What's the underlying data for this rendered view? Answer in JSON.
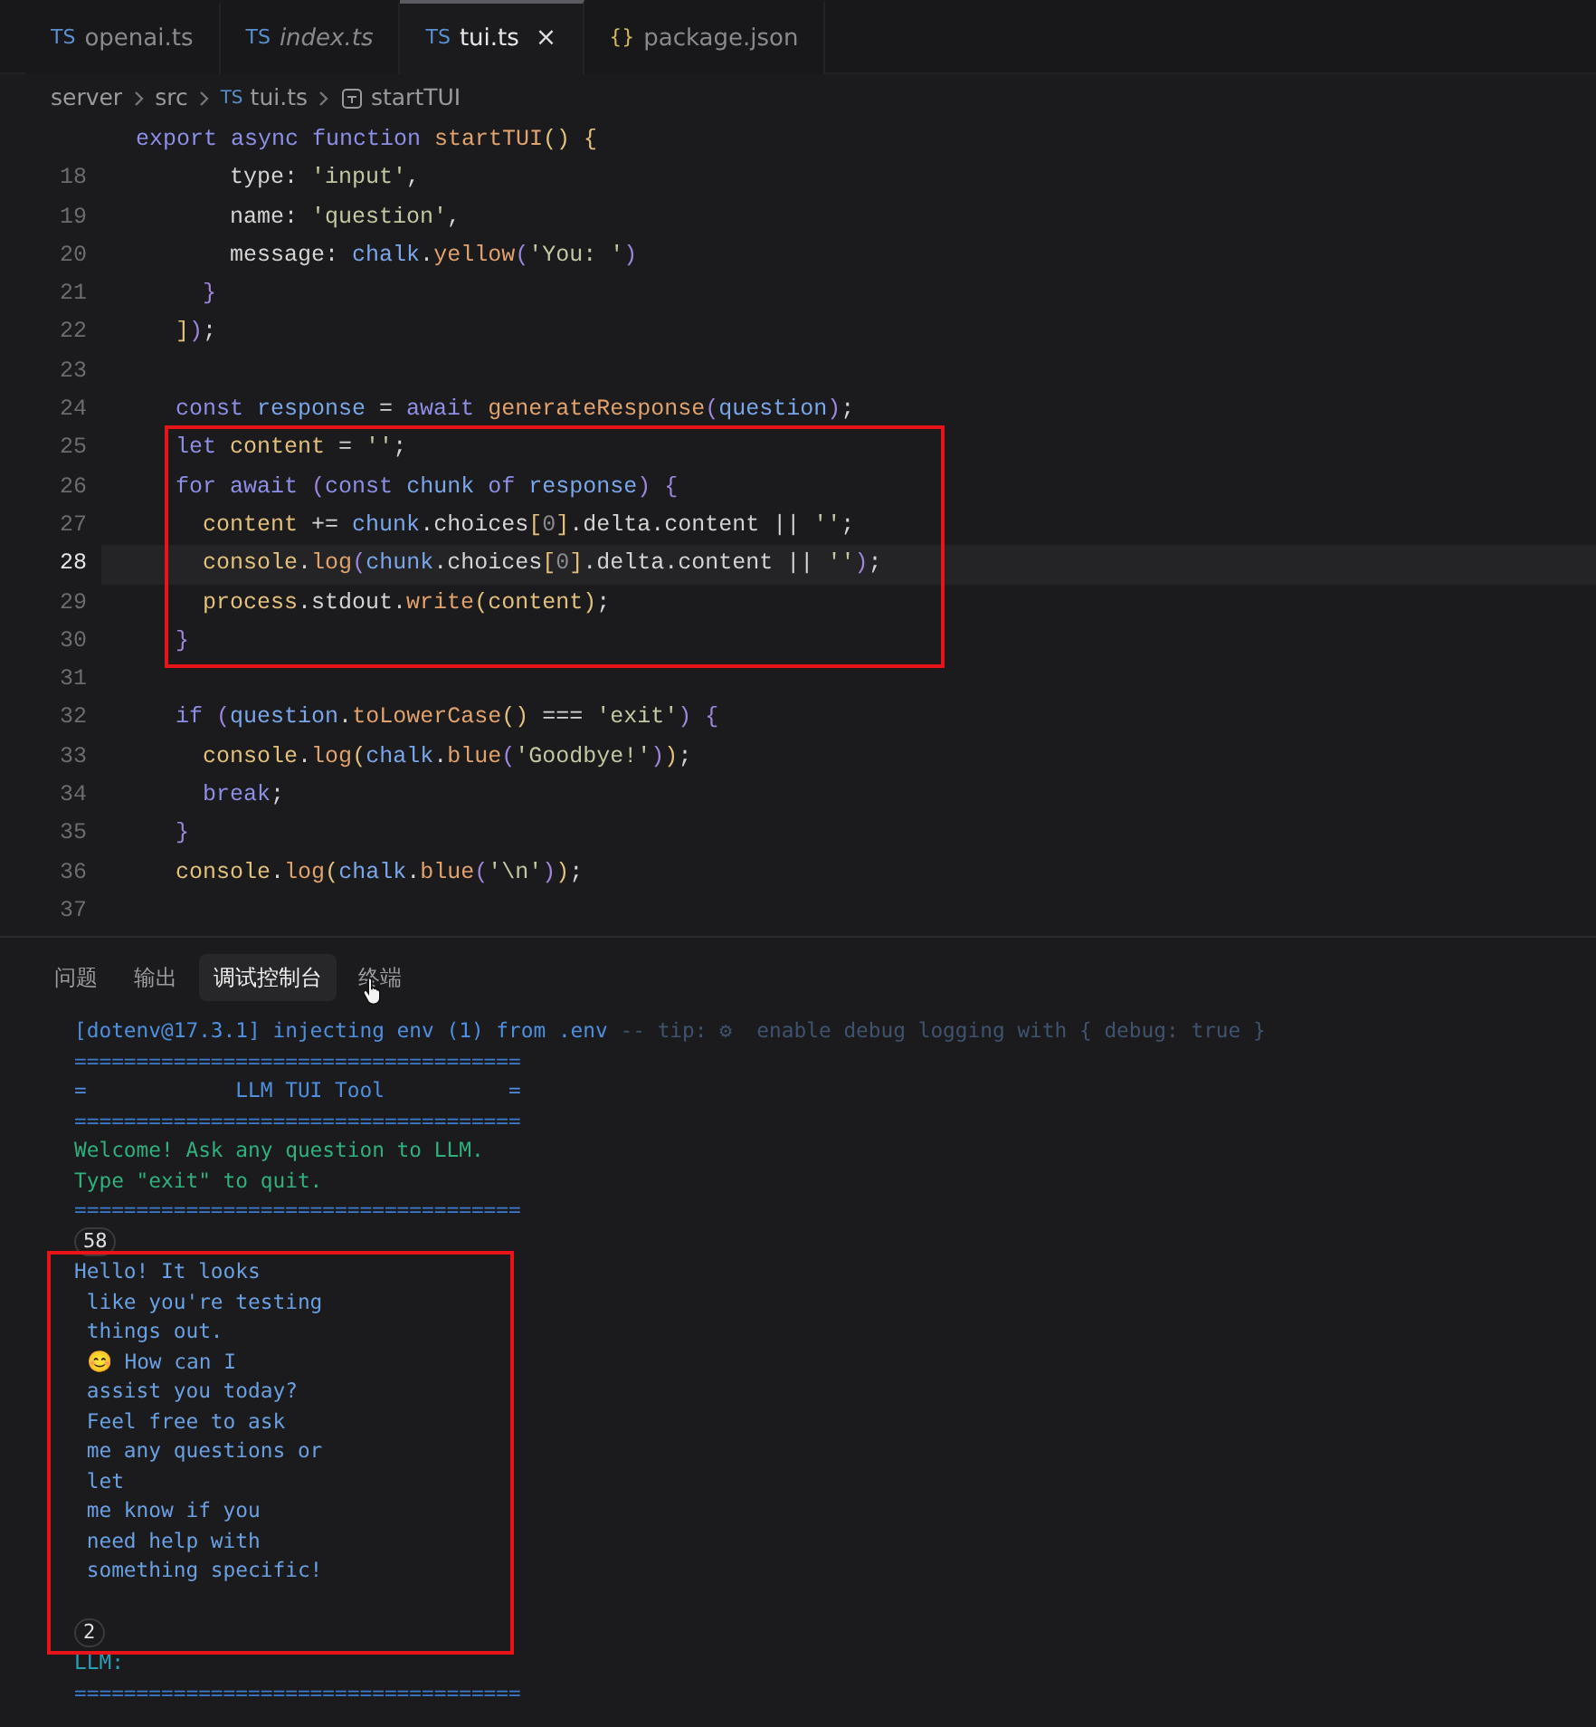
{
  "editor_tabs": [
    {
      "icon": "TS",
      "color": "#5a8fd0",
      "label": "openai.ts",
      "italic": false,
      "selected": false
    },
    {
      "icon": "TS",
      "color": "#5a8fd0",
      "label": "index.ts",
      "italic": true,
      "selected": false
    },
    {
      "icon": "TS",
      "color": "#5a8fd0",
      "label": "tui.ts",
      "italic": false,
      "selected": true,
      "close": "×"
    },
    {
      "icon": "{}",
      "color": "#d7ba5d",
      "label": "package.json",
      "italic": false,
      "selected": false
    }
  ],
  "breadcrumb": [
    {
      "kind": "folder",
      "label": "server"
    },
    {
      "kind": "folder",
      "label": "src"
    },
    {
      "kind": "file",
      "icon": "TS",
      "label": "tui.ts"
    },
    {
      "kind": "symbol",
      "label": "startTUI"
    }
  ],
  "sticky_line": {
    "tokens": [
      {
        "text": "export async function ",
        "color": "#8d8fe6"
      },
      {
        "text": "startTUI",
        "color": "#e2a26c"
      },
      {
        "text": "() {",
        "color": "#e3c07c"
      }
    ]
  },
  "code_lines": [
    {
      "number": "18",
      "current": false,
      "boxed": false,
      "tokens": [
        {
          "text": "        type: ",
          "color": "#d4d4d4"
        },
        {
          "text": "'input'",
          "color": "#c2c8a2"
        },
        {
          "text": ",",
          "color": "#d4d4d4"
        }
      ]
    },
    {
      "number": "19",
      "current": false,
      "boxed": false,
      "tokens": [
        {
          "text": "        name: ",
          "color": "#d4d4d4"
        },
        {
          "text": "'question'",
          "color": "#c2c8a2"
        },
        {
          "text": ",",
          "color": "#d4d4d4"
        }
      ]
    },
    {
      "number": "20",
      "current": false,
      "boxed": false,
      "tokens": [
        {
          "text": "        message: ",
          "color": "#d4d4d4"
        },
        {
          "text": "chalk",
          "color": "#7aa6ea"
        },
        {
          "text": ".",
          "color": "#d4d4d4"
        },
        {
          "text": "yellow",
          "color": "#e2a26c"
        },
        {
          "text": "(",
          "color": "#9d86db"
        },
        {
          "text": "'You: '",
          "color": "#c2c8a2"
        },
        {
          "text": ")",
          "color": "#9d86db"
        }
      ]
    },
    {
      "number": "21",
      "current": false,
      "boxed": false,
      "tokens": [
        {
          "text": "      }",
          "color": "#9d86db"
        }
      ]
    },
    {
      "number": "22",
      "current": false,
      "boxed": false,
      "tokens": [
        {
          "text": "    ]",
          "color": "#e3c07c"
        },
        {
          "text": ")",
          "color": "#9d86db"
        },
        {
          "text": ";",
          "color": "#d4d4d4"
        }
      ]
    },
    {
      "number": "23",
      "current": false,
      "boxed": false
    },
    {
      "number": "24",
      "current": false,
      "boxed": false,
      "tokens": [
        {
          "text": "    const ",
          "color": "#8d8fe6"
        },
        {
          "text": "response",
          "color": "#7aa6ea"
        },
        {
          "text": " = ",
          "color": "#d4d4d4"
        },
        {
          "text": "await ",
          "color": "#8d8fe6"
        },
        {
          "text": "generateResponse",
          "color": "#e2a26c"
        },
        {
          "text": "(",
          "color": "#9d86db"
        },
        {
          "text": "question",
          "color": "#7aa6ea"
        },
        {
          "text": ")",
          "color": "#9d86db"
        },
        {
          "text": ";",
          "color": "#d4d4d4"
        }
      ]
    },
    {
      "number": "25",
      "current": false,
      "boxed": true,
      "tokens": [
        {
          "text": "    let ",
          "color": "#8d8fe6"
        },
        {
          "text": "content",
          "color": "#e3c07c"
        },
        {
          "text": " = ",
          "color": "#d4d4d4"
        },
        {
          "text": "''",
          "color": "#c2c8a2"
        },
        {
          "text": ";",
          "color": "#d4d4d4"
        }
      ]
    },
    {
      "number": "26",
      "current": false,
      "boxed": true,
      "tokens": [
        {
          "text": "    for await ",
          "color": "#8d8fe6"
        },
        {
          "text": "(",
          "color": "#9d86db"
        },
        {
          "text": "const ",
          "color": "#8d8fe6"
        },
        {
          "text": "chunk ",
          "color": "#7aa6ea"
        },
        {
          "text": "of ",
          "color": "#8d8fe6"
        },
        {
          "text": "response",
          "color": "#7aa6ea"
        },
        {
          "text": ") {",
          "color": "#9d86db"
        }
      ]
    },
    {
      "number": "27",
      "current": false,
      "boxed": true,
      "tokens": [
        {
          "text": "      content",
          "color": "#e3c07c"
        },
        {
          "text": " += ",
          "color": "#d4d4d4"
        },
        {
          "text": "chunk",
          "color": "#7aa6ea"
        },
        {
          "text": ".choices",
          "color": "#d4d4d4"
        },
        {
          "text": "[",
          "color": "#e3c07c"
        },
        {
          "text": "0",
          "color": "#8a8a8e"
        },
        {
          "text": "]",
          "color": "#e3c07c"
        },
        {
          "text": ".delta.content || ",
          "color": "#d4d4d4"
        },
        {
          "text": "''",
          "color": "#c2c8a2"
        },
        {
          "text": ";",
          "color": "#d4d4d4"
        }
      ]
    },
    {
      "number": "28",
      "current": true,
      "boxed": true,
      "tokens": [
        {
          "text": "      console",
          "color": "#e3c07c"
        },
        {
          "text": ".",
          "color": "#d4d4d4"
        },
        {
          "text": "log",
          "color": "#e2a26c"
        },
        {
          "text": "(",
          "color": "#9d86db"
        },
        {
          "text": "chunk",
          "color": "#7aa6ea"
        },
        {
          "text": ".choices",
          "color": "#d4d4d4"
        },
        {
          "text": "[",
          "color": "#e3c07c"
        },
        {
          "text": "0",
          "color": "#8a8a8e"
        },
        {
          "text": "]",
          "color": "#e3c07c"
        },
        {
          "text": ".delta.content || ",
          "color": "#d4d4d4"
        },
        {
          "text": "''",
          "color": "#c2c8a2"
        },
        {
          "text": ")",
          "color": "#9d86db"
        },
        {
          "text": ";",
          "color": "#d4d4d4"
        }
      ]
    },
    {
      "number": "29",
      "current": false,
      "boxed": true,
      "tokens": [
        {
          "text": "      process",
          "color": "#e3c07c"
        },
        {
          "text": ".stdout.",
          "color": "#d4d4d4"
        },
        {
          "text": "write",
          "color": "#e2a26c"
        },
        {
          "text": "(",
          "color": "#e3c07c"
        },
        {
          "text": "content",
          "color": "#e3c07c"
        },
        {
          "text": ")",
          "color": "#e3c07c"
        },
        {
          "text": ";",
          "color": "#d4d4d4"
        }
      ]
    },
    {
      "number": "30",
      "current": false,
      "boxed": true,
      "tokens": [
        {
          "text": "    }",
          "color": "#9d86db"
        }
      ]
    },
    {
      "number": "31",
      "current": false,
      "boxed": false
    },
    {
      "number": "32",
      "current": false,
      "boxed": false,
      "tokens": [
        {
          "text": "    if ",
          "color": "#8d8fe6"
        },
        {
          "text": "(",
          "color": "#9d86db"
        },
        {
          "text": "question",
          "color": "#7aa6ea"
        },
        {
          "text": ".",
          "color": "#d4d4d4"
        },
        {
          "text": "toLowerCase",
          "color": "#e2a26c"
        },
        {
          "text": "()",
          "color": "#e3c07c"
        },
        {
          "text": " === ",
          "color": "#d4d4d4"
        },
        {
          "text": "'exit'",
          "color": "#c2c8a2"
        },
        {
          "text": ") {",
          "color": "#9d86db"
        }
      ]
    },
    {
      "number": "33",
      "current": false,
      "boxed": false,
      "tokens": [
        {
          "text": "      console",
          "color": "#e3c07c"
        },
        {
          "text": ".",
          "color": "#d4d4d4"
        },
        {
          "text": "log",
          "color": "#e2a26c"
        },
        {
          "text": "(",
          "color": "#e3c07c"
        },
        {
          "text": "chalk",
          "color": "#7aa6ea"
        },
        {
          "text": ".",
          "color": "#d4d4d4"
        },
        {
          "text": "blue",
          "color": "#e2a26c"
        },
        {
          "text": "(",
          "color": "#9d86db"
        },
        {
          "text": "'Goodbye!'",
          "color": "#c2c8a2"
        },
        {
          "text": ")",
          "color": "#9d86db"
        },
        {
          "text": ")",
          "color": "#e3c07c"
        },
        {
          "text": ";",
          "color": "#d4d4d4"
        }
      ]
    },
    {
      "number": "34",
      "current": false,
      "boxed": false,
      "tokens": [
        {
          "text": "      break",
          "color": "#8d8fe6"
        },
        {
          "text": ";",
          "color": "#d4d4d4"
        }
      ]
    },
    {
      "number": "35",
      "current": false,
      "boxed": false,
      "tokens": [
        {
          "text": "    }",
          "color": "#9d86db"
        }
      ]
    },
    {
      "number": "36",
      "current": false,
      "boxed": false,
      "tokens": [
        {
          "text": "    console",
          "color": "#e3c07c"
        },
        {
          "text": ".",
          "color": "#d4d4d4"
        },
        {
          "text": "log",
          "color": "#e2a26c"
        },
        {
          "text": "(",
          "color": "#e3c07c"
        },
        {
          "text": "chalk",
          "color": "#7aa6ea"
        },
        {
          "text": ".",
          "color": "#d4d4d4"
        },
        {
          "text": "blue",
          "color": "#e2a26c"
        },
        {
          "text": "(",
          "color": "#9d86db"
        },
        {
          "text": "'\\n'",
          "color": "#c2c8a2"
        },
        {
          "text": ")",
          "color": "#9d86db"
        },
        {
          "text": ")",
          "color": "#e3c07c"
        },
        {
          "text": ";",
          "color": "#d4d4d4"
        }
      ]
    },
    {
      "number": "37",
      "current": false,
      "boxed": false
    }
  ],
  "panel_tabs": [
    {
      "label": "问题",
      "selected": false,
      "hovered": false
    },
    {
      "label": "输出",
      "selected": false,
      "hovered": false
    },
    {
      "label": "调试控制台",
      "selected": true,
      "hovered": false
    },
    {
      "label": "终端",
      "selected": false,
      "hovered": true
    }
  ],
  "terminal_lines": [
    {
      "kind": "text",
      "boxed": false,
      "segments": [
        {
          "text": "[dotenv@17.3.1] injecting env (1) from .env ",
          "color": "#4f8fe0"
        },
        {
          "text": "-- tip: ⚙  enable debug logging with { debug: true }",
          "color": "#3f536f"
        }
      ]
    },
    {
      "kind": "text",
      "boxed": false,
      "segments": [
        {
          "text": "====================================",
          "color": "#3c7cd0"
        }
      ]
    },
    {
      "kind": "text",
      "boxed": false,
      "segments": [
        {
          "text": "=            LLM TUI Tool          =",
          "color": "#4f8fe0"
        }
      ]
    },
    {
      "kind": "text",
      "boxed": false,
      "segments": [
        {
          "text": "====================================",
          "color": "#3c7cd0"
        }
      ]
    },
    {
      "kind": "text",
      "boxed": false,
      "segments": [
        {
          "text": "Welcome! Ask any question to LLM.",
          "color": "#2fb07c"
        }
      ]
    },
    {
      "kind": "text",
      "boxed": false,
      "segments": [
        {
          "text": "Type \"exit\" to quit.",
          "color": "#2fb07c"
        }
      ]
    },
    {
      "kind": "text",
      "boxed": false,
      "segments": [
        {
          "text": "====================================",
          "color": "#3c7cd0"
        }
      ]
    },
    {
      "kind": "count",
      "boxed": false,
      "text": "58"
    },
    {
      "kind": "text",
      "boxed": true,
      "segments": [
        {
          "text": "Hello! It looks",
          "color": "#6aa0e2"
        }
      ]
    },
    {
      "kind": "text",
      "boxed": true,
      "segments": [
        {
          "text": " like you're testing",
          "color": "#6aa0e2"
        }
      ]
    },
    {
      "kind": "text",
      "boxed": true,
      "segments": [
        {
          "text": " things out.",
          "color": "#6aa0e2"
        }
      ]
    },
    {
      "kind": "text",
      "boxed": true,
      "segments": [
        {
          "text": " 😊 How can I",
          "color": "#6aa0e2"
        }
      ]
    },
    {
      "kind": "text",
      "boxed": true,
      "segments": [
        {
          "text": " assist you today?",
          "color": "#6aa0e2"
        }
      ]
    },
    {
      "kind": "text",
      "boxed": true,
      "segments": [
        {
          "text": " Feel free to ask",
          "color": "#6aa0e2"
        }
      ]
    },
    {
      "kind": "text",
      "boxed": true,
      "segments": [
        {
          "text": " me any questions or",
          "color": "#6aa0e2"
        }
      ]
    },
    {
      "kind": "text",
      "boxed": true,
      "segments": [
        {
          "text": " let",
          "color": "#6aa0e2"
        }
      ]
    },
    {
      "kind": "text",
      "boxed": true,
      "segments": [
        {
          "text": " me know if you",
          "color": "#6aa0e2"
        }
      ]
    },
    {
      "kind": "text",
      "boxed": true,
      "segments": [
        {
          "text": " need help with",
          "color": "#6aa0e2"
        }
      ]
    },
    {
      "kind": "text",
      "boxed": true,
      "segments": [
        {
          "text": " something specific!",
          "color": "#6aa0e2"
        }
      ]
    },
    {
      "kind": "blank",
      "boxed": true
    },
    {
      "kind": "count",
      "boxed": true,
      "text": "2"
    },
    {
      "kind": "text",
      "boxed": false,
      "segments": [
        {
          "text": "LLM:",
          "color": "#2c9fb4"
        }
      ]
    },
    {
      "kind": "text",
      "boxed": false,
      "segments": [
        {
          "text": "====================================",
          "color": "#3c7cd0"
        }
      ]
    }
  ]
}
